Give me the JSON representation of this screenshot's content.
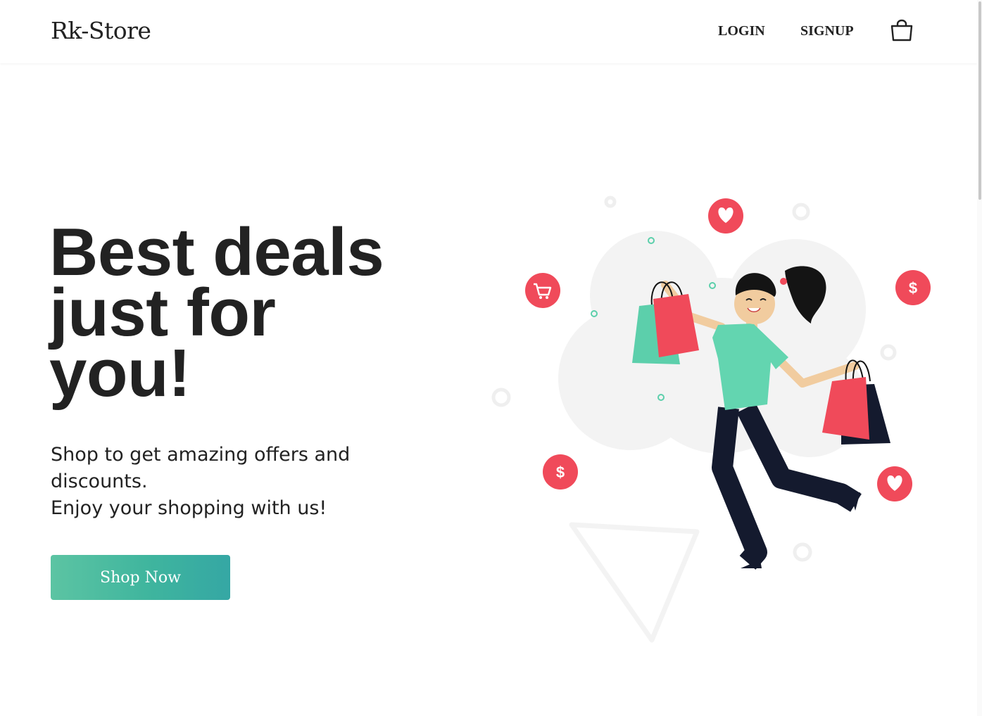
{
  "navbar": {
    "brand": "Rk-Store",
    "login_label": "LOGIN",
    "signup_label": "SIGNUP",
    "cart_icon": "shopping-bag-icon"
  },
  "hero": {
    "title_line1": "Best deals",
    "title_line2": "just for",
    "title_line3": "you!",
    "subtitle_line1": "Shop to get amazing offers and discounts.",
    "subtitle_line2": "Enjoy your shopping with us!",
    "cta_label": "Shop Now"
  },
  "illustration": {
    "dollar_label": "$",
    "icons": [
      "heart-icon",
      "cart-icon",
      "dollar-icon"
    ]
  },
  "colors": {
    "accent_red": "#f04a5a",
    "accent_green": "#5ccfab",
    "cta_gradient_start": "#5cc4a3",
    "cta_gradient_end": "#35a7a4",
    "text_dark": "#222222"
  }
}
